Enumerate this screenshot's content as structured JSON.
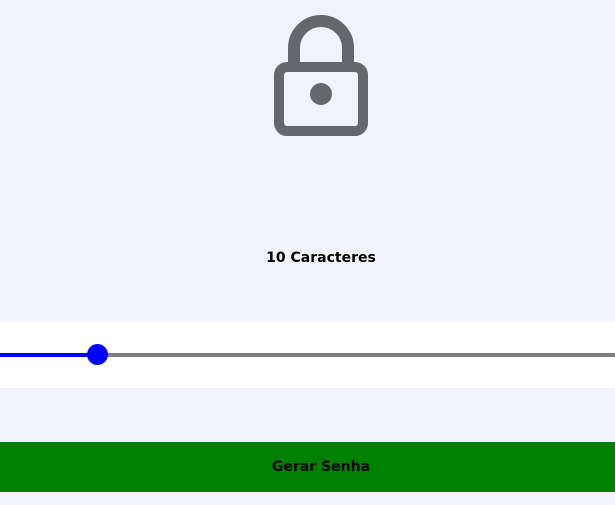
{
  "header": {
    "icon": "lock-icon",
    "icon_color": "#66676c"
  },
  "length": {
    "label": "10 Caracteres",
    "value": 10
  },
  "slider": {
    "position_fraction": 0.158,
    "fill_color": "#0000ff",
    "track_color": "#808080"
  },
  "actions": {
    "generate_label": "Gerar Senha",
    "generate_color": "#008000"
  }
}
